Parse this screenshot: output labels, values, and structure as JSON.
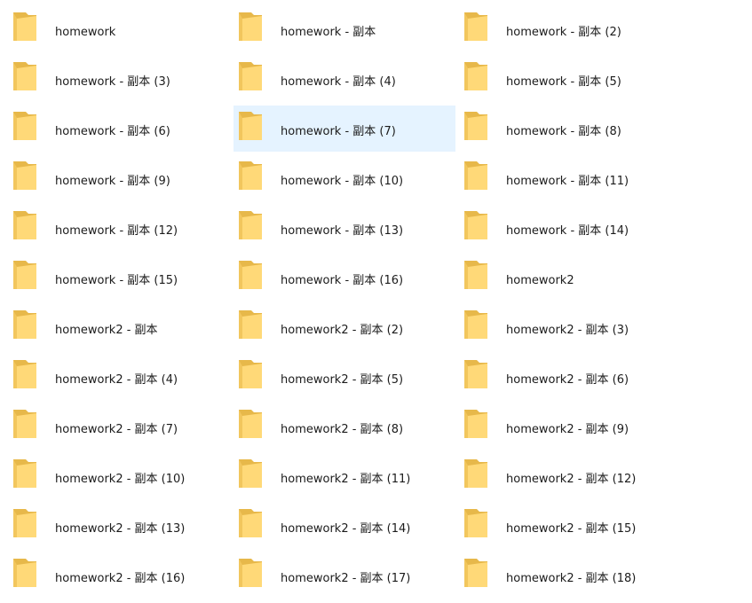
{
  "explorer": {
    "selected_index": 7,
    "items": [
      {
        "name": "homework",
        "icon": "folder-icon"
      },
      {
        "name": "homework - 副本",
        "icon": "folder-icon"
      },
      {
        "name": "homework - 副本 (2)",
        "icon": "folder-icon"
      },
      {
        "name": "homework - 副本 (3)",
        "icon": "folder-icon"
      },
      {
        "name": "homework - 副本 (4)",
        "icon": "folder-icon"
      },
      {
        "name": "homework - 副本 (5)",
        "icon": "folder-icon"
      },
      {
        "name": "homework - 副本 (6)",
        "icon": "folder-icon"
      },
      {
        "name": "homework - 副本 (7)",
        "icon": "folder-icon"
      },
      {
        "name": "homework - 副本 (8)",
        "icon": "folder-icon"
      },
      {
        "name": "homework - 副本 (9)",
        "icon": "folder-icon"
      },
      {
        "name": "homework - 副本 (10)",
        "icon": "folder-icon"
      },
      {
        "name": "homework - 副本 (11)",
        "icon": "folder-icon"
      },
      {
        "name": "homework - 副本 (12)",
        "icon": "folder-icon"
      },
      {
        "name": "homework - 副本 (13)",
        "icon": "folder-icon"
      },
      {
        "name": "homework - 副本 (14)",
        "icon": "folder-icon"
      },
      {
        "name": "homework - 副本 (15)",
        "icon": "folder-icon"
      },
      {
        "name": "homework - 副本 (16)",
        "icon": "folder-icon"
      },
      {
        "name": "homework2",
        "icon": "folder-icon"
      },
      {
        "name": "homework2 - 副本",
        "icon": "folder-icon"
      },
      {
        "name": "homework2 - 副本 (2)",
        "icon": "folder-icon"
      },
      {
        "name": "homework2 - 副本 (3)",
        "icon": "folder-icon"
      },
      {
        "name": "homework2 - 副本 (4)",
        "icon": "folder-icon"
      },
      {
        "name": "homework2 - 副本 (5)",
        "icon": "folder-icon"
      },
      {
        "name": "homework2 - 副本 (6)",
        "icon": "folder-icon"
      },
      {
        "name": "homework2 - 副本 (7)",
        "icon": "folder-icon"
      },
      {
        "name": "homework2 - 副本 (8)",
        "icon": "folder-icon"
      },
      {
        "name": "homework2 - 副本 (9)",
        "icon": "folder-icon"
      },
      {
        "name": "homework2 - 副本 (10)",
        "icon": "folder-icon"
      },
      {
        "name": "homework2 - 副本 (11)",
        "icon": "folder-icon"
      },
      {
        "name": "homework2 - 副本 (12)",
        "icon": "folder-icon"
      },
      {
        "name": "homework2 - 副本 (13)",
        "icon": "folder-icon"
      },
      {
        "name": "homework2 - 副本 (14)",
        "icon": "folder-icon"
      },
      {
        "name": "homework2 - 副本 (15)",
        "icon": "folder-icon"
      },
      {
        "name": "homework2 - 副本 (16)",
        "icon": "folder-icon"
      },
      {
        "name": "homework2 - 副本 (17)",
        "icon": "folder-icon"
      },
      {
        "name": "homework2 - 副本 (18)",
        "icon": "folder-icon"
      }
    ]
  },
  "colors": {
    "selection_bg": "#e5f3ff",
    "folder_back": "#e7b84a",
    "folder_front": "#ffd978",
    "text": "#1b1b1b"
  }
}
